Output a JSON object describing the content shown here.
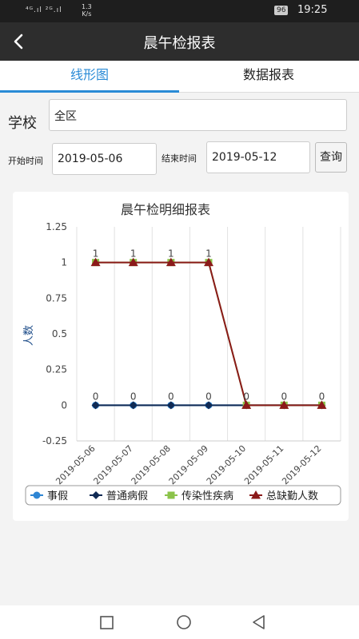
{
  "status": {
    "signal": "⁴ᴳ.ıl ²ᴳ.ıl",
    "speed_value": "1.3",
    "speed_unit": "K/s",
    "battery": "96",
    "time": "19:25"
  },
  "appbar": {
    "title": "晨午检报表"
  },
  "tabs": [
    {
      "label": "线形图",
      "active": true
    },
    {
      "label": "数据报表",
      "active": false
    }
  ],
  "filters": {
    "school_label": "学校",
    "school_value": "全区",
    "start_label": "开始时间",
    "start_value": "2019-05-06",
    "end_label": "结束时间",
    "end_value": "2019-05-12",
    "query_label": "查询"
  },
  "colors": {
    "accent": "#2a8bd6",
    "series_0": "#2f86d4",
    "series_1": "#102a54",
    "series_2": "#8bc34a",
    "series_3": "#8b1a1a"
  },
  "chart_data": {
    "type": "line",
    "title": "晨午检明细报表",
    "ylabel": "人数",
    "xlabel": "",
    "categories": [
      "2019-05-06",
      "2019-05-07",
      "2019-05-08",
      "2019-05-09",
      "2019-05-10",
      "2019-05-11",
      "2019-05-12"
    ],
    "ylim": [
      -0.25,
      1.25
    ],
    "yticks": [
      "1.25",
      "1",
      "0.75",
      "0.5",
      "0.25",
      "0",
      "-0.25"
    ],
    "grid": "vertical",
    "legend_position": "bottom",
    "series": [
      {
        "name": "事假",
        "values": [
          0,
          0,
          0,
          0,
          0,
          0,
          0
        ],
        "marker": "circle",
        "color": "#2f86d4"
      },
      {
        "name": "普通病假",
        "values": [
          0,
          0,
          0,
          0,
          0,
          0,
          0
        ],
        "marker": "diamond",
        "color": "#102a54"
      },
      {
        "name": "传染性疾病",
        "values": [
          1,
          1,
          1,
          1,
          0,
          0,
          0
        ],
        "marker": "square",
        "color": "#8bc34a"
      },
      {
        "name": "总缺勤人数",
        "values": [
          1,
          1,
          1,
          1,
          0,
          0,
          0
        ],
        "marker": "triangle",
        "color": "#8b1a1a"
      }
    ],
    "data_labels": [
      {
        "text": "1",
        "series": 3,
        "index": 0
      },
      {
        "text": "1",
        "series": 3,
        "index": 1
      },
      {
        "text": "1",
        "series": 3,
        "index": 2
      },
      {
        "text": "1",
        "series": 3,
        "index": 3
      },
      {
        "text": "0",
        "series": 1,
        "index": 0
      },
      {
        "text": "0",
        "series": 1,
        "index": 1
      },
      {
        "text": "0",
        "series": 1,
        "index": 2
      },
      {
        "text": "0",
        "series": 1,
        "index": 3
      },
      {
        "text": "0",
        "series": 1,
        "index": 4
      },
      {
        "text": "0",
        "series": 1,
        "index": 5
      },
      {
        "text": "0",
        "series": 1,
        "index": 6
      }
    ]
  }
}
